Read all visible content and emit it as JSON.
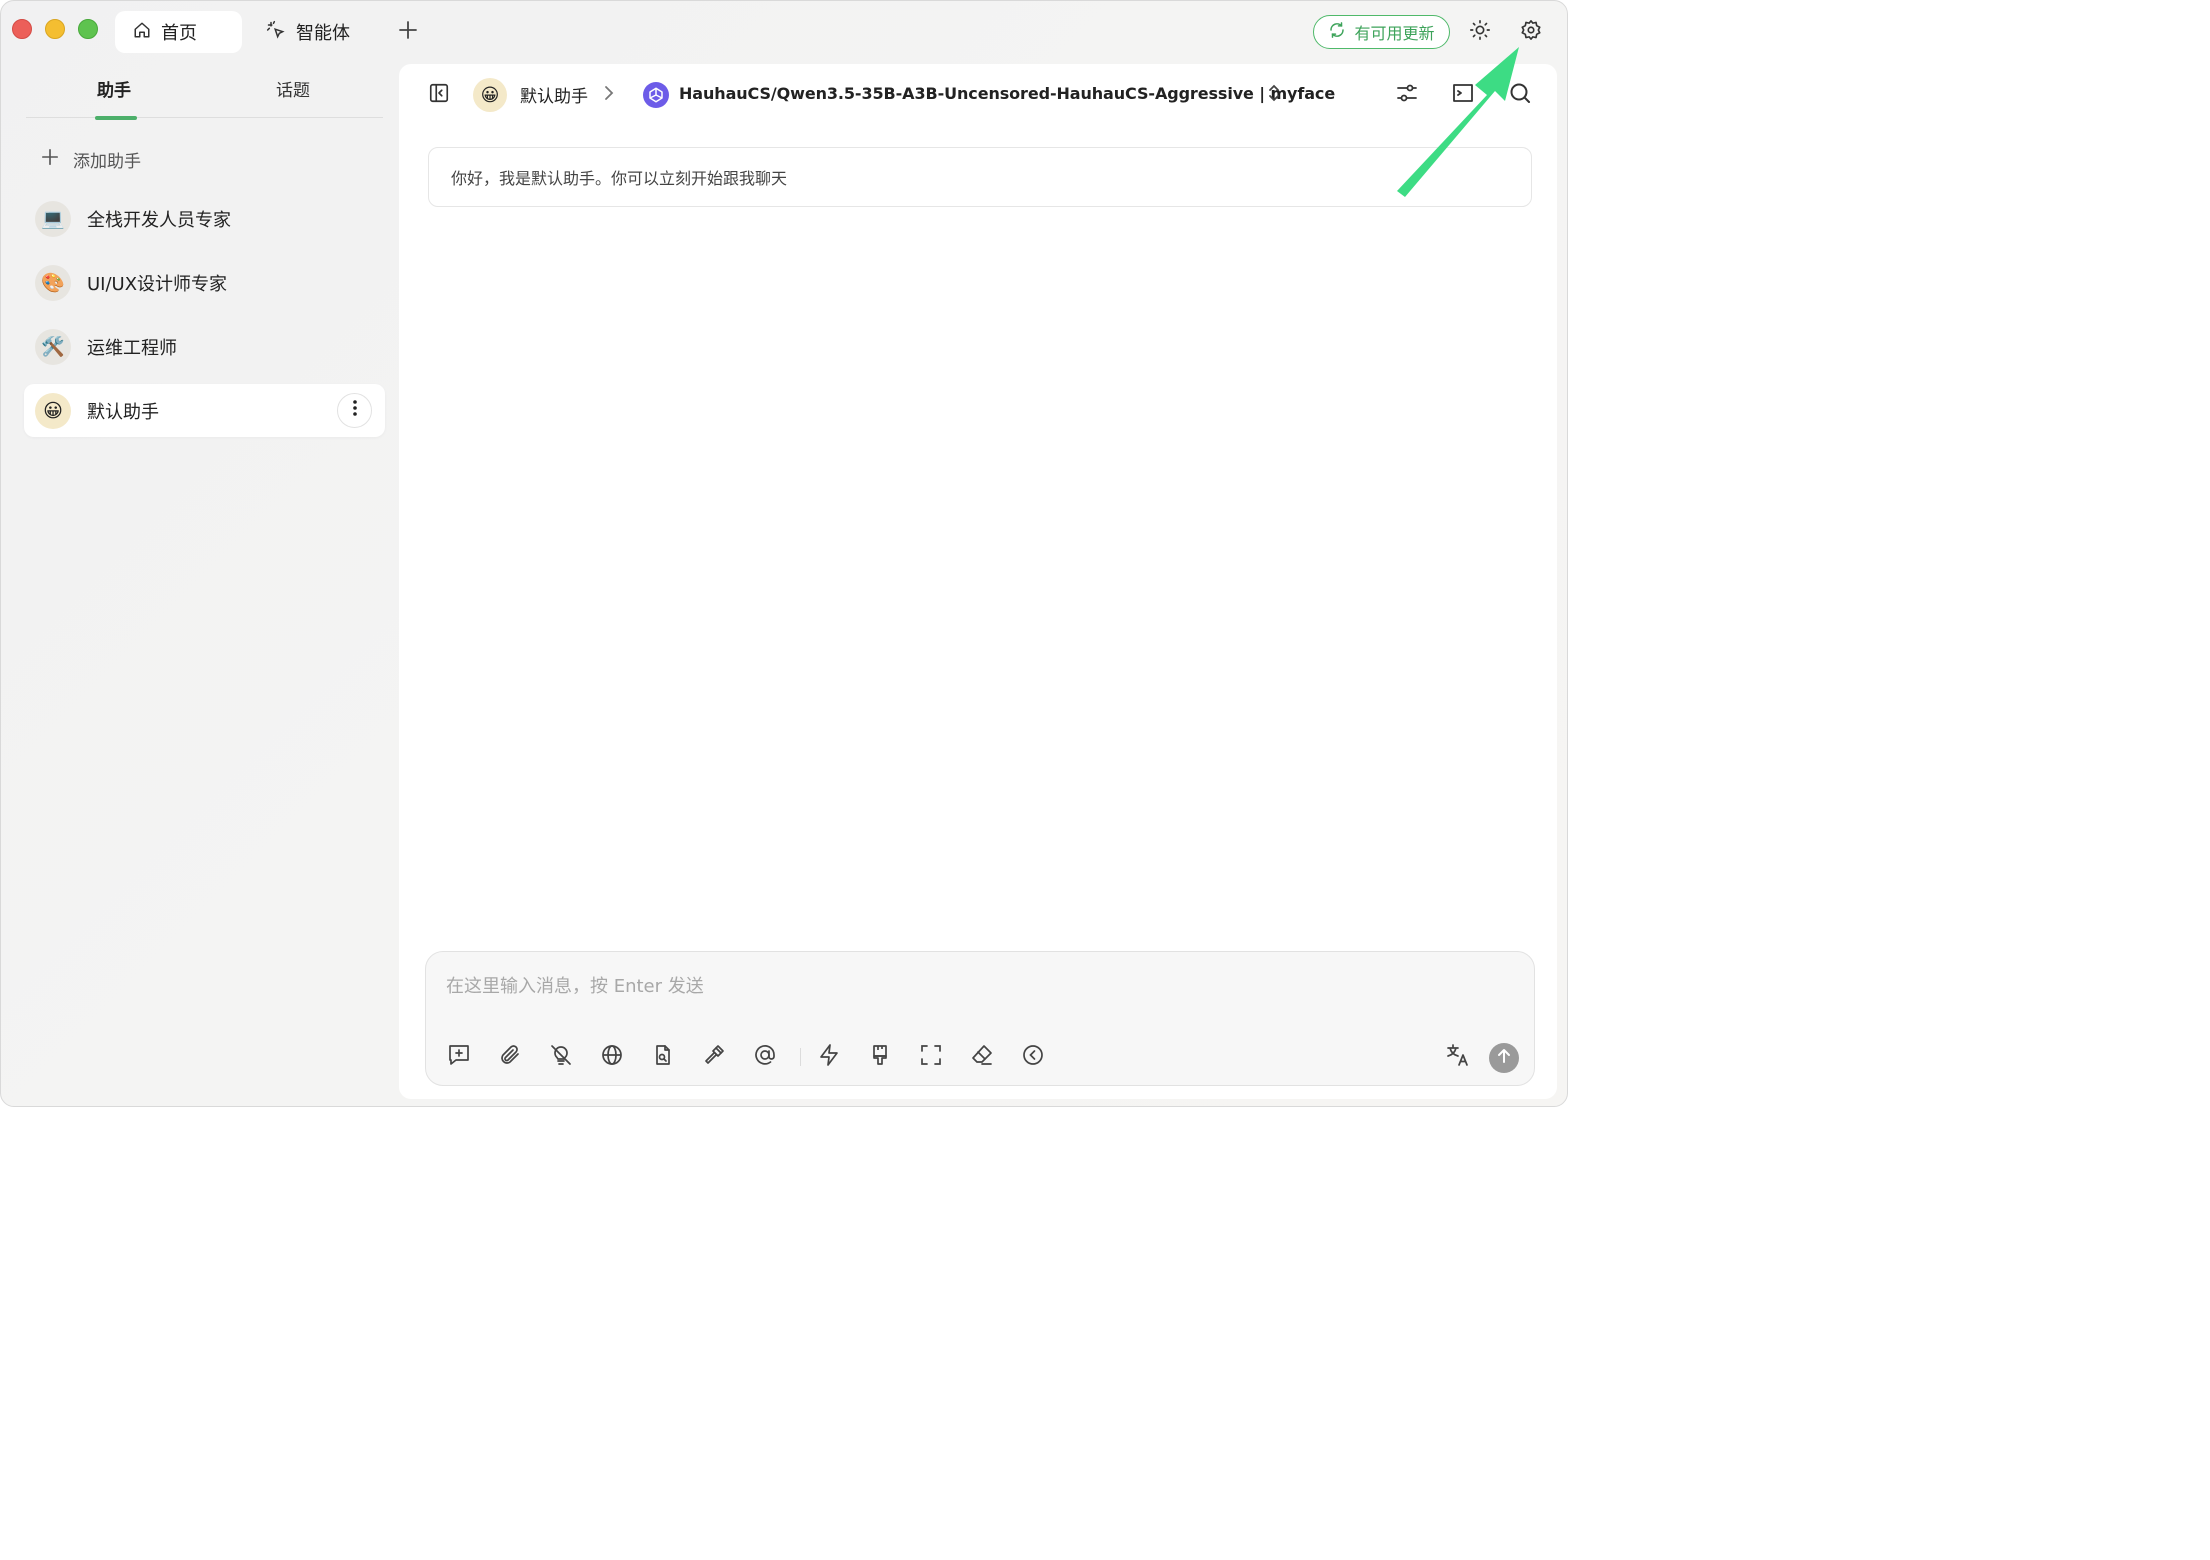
{
  "window": {
    "traffic_lights": [
      "close",
      "minimize",
      "zoom"
    ]
  },
  "titlebar": {
    "tabs": [
      {
        "label": "首页",
        "icon": "home-icon"
      },
      {
        "label": "智能体",
        "icon": "sparkle-cursor-icon"
      }
    ],
    "add_tab_icon": "plus-icon",
    "update_label": "有可用更新",
    "update_icon": "refresh-icon",
    "theme_icon": "sun-icon",
    "settings_icon": "gear-icon"
  },
  "sidebar": {
    "tabs": [
      {
        "label": "助手",
        "active": true
      },
      {
        "label": "话题",
        "active": false
      }
    ],
    "add_label": "添加助手",
    "items": [
      {
        "label": "全栈开发人员专家",
        "avatar": "💻"
      },
      {
        "label": "UI/UX设计师专家",
        "avatar": "🎨"
      },
      {
        "label": "运维工程师",
        "avatar": "🛠️"
      },
      {
        "label": "默认助手",
        "avatar": "😀",
        "active": true
      }
    ]
  },
  "header": {
    "assistant_name": "默认助手",
    "assistant_avatar": "😀",
    "model_name": "HauhauCS/Qwen3.5-35B-A3B-Uncensored-HauhauCS-Aggressive | myface",
    "right_icons": [
      "sliders-icon",
      "topic-list-icon",
      "search-icon"
    ]
  },
  "chat": {
    "greeting": "你好，我是默认助手。你可以立刻开始跟我聊天"
  },
  "composer": {
    "placeholder": "在这里输入消息，按 Enter 发送",
    "value": "",
    "tools": [
      "new-topic-icon",
      "attachment-icon",
      "thinking-off-icon",
      "web-search-icon",
      "knowledge-file-icon",
      "mcp-hammer-icon",
      "mention-icon",
      "quick-phrase-icon",
      "paint-brush-icon",
      "fullscreen-icon",
      "clear-eraser-icon",
      "collapse-icon"
    ],
    "translate_icon": "translate-icon",
    "send_icon": "arrow-up-icon"
  },
  "colors": {
    "accent": "#4caf6a",
    "update_border": "#4fb96a",
    "annotation_arrow": "#3ddc84"
  }
}
